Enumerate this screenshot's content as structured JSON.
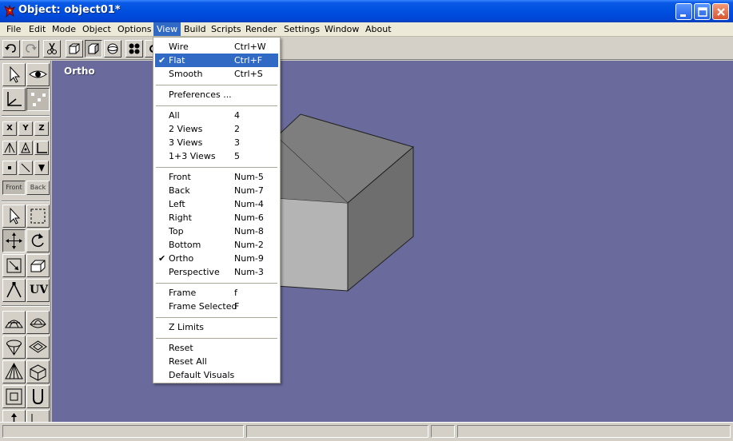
{
  "window": {
    "title": "Object: object01*",
    "app_icon": "red-dragon-icon",
    "controls": [
      "minimize-icon",
      "maximize-icon",
      "close-icon"
    ]
  },
  "menubar": {
    "items": [
      "File",
      "Edit",
      "Mode",
      "Object",
      "Options",
      "View",
      "Build",
      "Scripts",
      "Render",
      "Settings",
      "Window",
      "About"
    ],
    "active": "View"
  },
  "toolbar": {
    "buttons": [
      "undo-icon",
      "redo-icon",
      "cut-icon",
      "view-cube-icon",
      "view-box-icon",
      "sphere-icon",
      "four-views-icon",
      "settings-icon"
    ]
  },
  "palette": {
    "axis_buttons": [
      "X",
      "Y",
      "Z"
    ],
    "front_label": "Front",
    "back_label": "Back",
    "uv_label": "UV"
  },
  "viewport": {
    "label": "Ortho",
    "background_color": "#6a6a9c",
    "object": "cube"
  },
  "view_menu": {
    "items": [
      {
        "label": "Wire",
        "shortcut": "Ctrl+W",
        "checked": false,
        "highlighted": false
      },
      {
        "label": "Flat",
        "shortcut": "Ctrl+F",
        "checked": true,
        "highlighted": true
      },
      {
        "label": "Smooth",
        "shortcut": "Ctrl+S",
        "checked": false,
        "highlighted": false
      },
      {
        "separator": true
      },
      {
        "label": "Preferences ...",
        "shortcut": "",
        "checked": false,
        "highlighted": false
      },
      {
        "separator": true
      },
      {
        "label": "All",
        "shortcut": "4",
        "checked": false,
        "highlighted": false
      },
      {
        "label": "2 Views",
        "shortcut": "2",
        "checked": false,
        "highlighted": false
      },
      {
        "label": "3 Views",
        "shortcut": "3",
        "checked": false,
        "highlighted": false
      },
      {
        "label": "1+3 Views",
        "shortcut": "5",
        "checked": false,
        "highlighted": false
      },
      {
        "separator": true
      },
      {
        "label": "Front",
        "shortcut": "Num-5",
        "checked": false,
        "highlighted": false
      },
      {
        "label": "Back",
        "shortcut": "Num-7",
        "checked": false,
        "highlighted": false
      },
      {
        "label": "Left",
        "shortcut": "Num-4",
        "checked": false,
        "highlighted": false
      },
      {
        "label": "Right",
        "shortcut": "Num-6",
        "checked": false,
        "highlighted": false
      },
      {
        "label": "Top",
        "shortcut": "Num-8",
        "checked": false,
        "highlighted": false
      },
      {
        "label": "Bottom",
        "shortcut": "Num-2",
        "checked": false,
        "highlighted": false
      },
      {
        "label": "Ortho",
        "shortcut": "Num-9",
        "checked": true,
        "highlighted": false
      },
      {
        "label": "Perspective",
        "shortcut": "Num-3",
        "checked": false,
        "highlighted": false
      },
      {
        "separator": true
      },
      {
        "label": "Frame",
        "shortcut": "f",
        "checked": false,
        "highlighted": false
      },
      {
        "label": "Frame Selected",
        "shortcut": "F",
        "checked": false,
        "highlighted": false
      },
      {
        "separator": true
      },
      {
        "label": "Z Limits",
        "shortcut": "",
        "checked": false,
        "highlighted": false
      },
      {
        "separator": true
      },
      {
        "label": "Reset",
        "shortcut": "",
        "checked": false,
        "highlighted": false
      },
      {
        "label": "Reset All",
        "shortcut": "",
        "checked": false,
        "highlighted": false
      },
      {
        "label": "Default Visuals",
        "shortcut": "",
        "checked": false,
        "highlighted": false
      }
    ]
  },
  "statusbar": {
    "panes": [
      "",
      "",
      "",
      ""
    ]
  }
}
